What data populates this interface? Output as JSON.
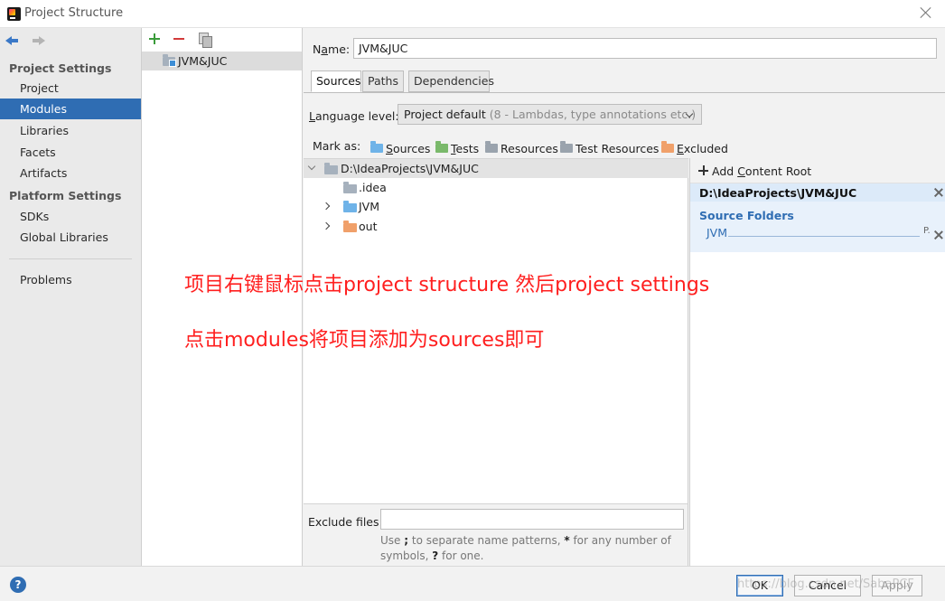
{
  "window": {
    "title": "Project Structure"
  },
  "nav": {
    "project_settings_header": "Project Settings",
    "project_settings_items": [
      "Project",
      "Modules",
      "Libraries",
      "Facets",
      "Artifacts"
    ],
    "platform_settings_header": "Platform Settings",
    "platform_settings_items": [
      "SDKs",
      "Global Libraries"
    ],
    "problems": "Problems",
    "selected": "Modules"
  },
  "modules": {
    "items": [
      "JVM&JUC"
    ]
  },
  "main": {
    "name_label_pre": "N",
    "name_label_ul": "a",
    "name_label_post": "me:",
    "name_value": "JVM&JUC",
    "tabs": [
      "Sources",
      "Paths",
      "Dependencies"
    ],
    "active_tab": "Sources",
    "language_label_ul": "L",
    "language_label_post": "anguage level:",
    "language_value": "Project default",
    "language_hint": "(8 - Lambdas, type annotations etc.)",
    "mark_as_label": "Mark as:",
    "mark_options": [
      {
        "ul": "S",
        "rest": "ources",
        "color": "#6fb3e8"
      },
      {
        "ul": "T",
        "rest": "ests",
        "color": "#7ab96b"
      },
      {
        "ul": "",
        "rest": "Resources",
        "color": "#9aa3ad"
      },
      {
        "ul": "",
        "rest": "Test Resources",
        "color": "#9aa3ad"
      },
      {
        "ul": "E",
        "rest": "xcluded",
        "color": "#f0a06a"
      }
    ],
    "tree": {
      "root": "D:\\IdeaProjects\\JVM&JUC",
      "children": [
        ".idea",
        "JVM",
        "out"
      ]
    },
    "right_panel": {
      "add_pre": "Add ",
      "add_ul": "C",
      "add_post": "ontent Root",
      "content_root": "D:\\IdeaProjects\\JVM&JUC",
      "source_folders_label": "Source Folders",
      "source_folder": "JVM",
      "source_folder_suffix": "P."
    },
    "exclude_label": "Exclude files:",
    "exclude_value": "",
    "exclude_help_1": "Use ",
    "exclude_help_semicolon": ";",
    "exclude_help_2": " to separate name patterns, ",
    "exclude_help_star": "*",
    "exclude_help_3": " for any number of symbols, ",
    "exclude_help_q": "?",
    "exclude_help_4": " for one."
  },
  "annotations": {
    "line1": "项目右键鼠标点击project structure 然后project settings",
    "line2": "点击modules将项目添加为sources即可"
  },
  "buttons": {
    "help": "?",
    "ok": "OK",
    "cancel": "Cancel",
    "apply": "Apply"
  },
  "watermark": "https://blog.csdn.net/SabaPCF",
  "colors": {
    "accent": "#2f6db3",
    "annotation": "#ff1f1f"
  }
}
